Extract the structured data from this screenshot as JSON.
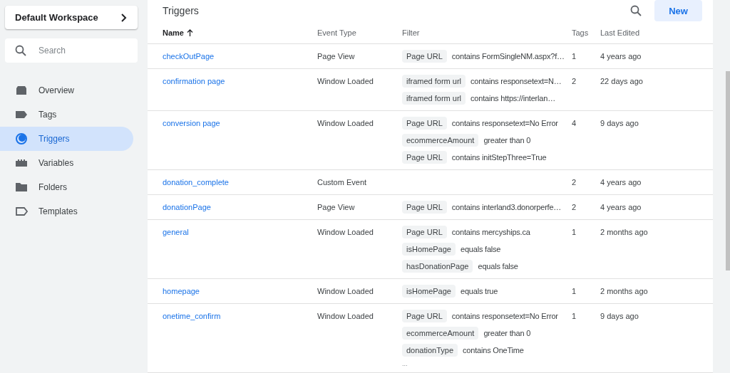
{
  "workspace": {
    "label": "Default Workspace"
  },
  "search": {
    "placeholder": "Search"
  },
  "nav": [
    {
      "label": "Overview",
      "selected": false
    },
    {
      "label": "Tags",
      "selected": false
    },
    {
      "label": "Triggers",
      "selected": true
    },
    {
      "label": "Variables",
      "selected": false
    },
    {
      "label": "Folders",
      "selected": false
    },
    {
      "label": "Templates",
      "selected": false
    }
  ],
  "panel": {
    "title": "Triggers",
    "new_button": "New"
  },
  "table": {
    "columns": [
      "Name",
      "Event Type",
      "Filter",
      "Tags",
      "Last Edited"
    ],
    "rows": [
      {
        "name": "checkOutPage",
        "event": "Page View",
        "filters": [
          {
            "variable": "Page URL",
            "condition": "contains FormSingleNM.aspx?f…"
          }
        ],
        "tags": "1",
        "edited": "4 years ago"
      },
      {
        "name": "confirmation page",
        "event": "Window Loaded",
        "filters": [
          {
            "variable": "iframed form url",
            "condition": "contains responsetext=N…"
          },
          {
            "variable": "iframed form url",
            "condition": "contains https://interlan…"
          }
        ],
        "tags": "2",
        "edited": "22 days ago"
      },
      {
        "name": "conversion page",
        "event": "Window Loaded",
        "filters": [
          {
            "variable": "Page URL",
            "condition": "contains responsetext=No Error"
          },
          {
            "variable": "ecommerceAmount",
            "condition": "greater than 0"
          },
          {
            "variable": "Page URL",
            "condition": "contains initStepThree=True"
          }
        ],
        "tags": "4",
        "edited": "9 days ago"
      },
      {
        "name": "donation_complete",
        "event": "Custom Event",
        "filters": [],
        "tags": "2",
        "edited": "4 years ago"
      },
      {
        "name": "donationPage",
        "event": "Page View",
        "filters": [
          {
            "variable": "Page URL",
            "condition": "contains interland3.donorperfe…"
          }
        ],
        "tags": "2",
        "edited": "4 years ago"
      },
      {
        "name": "general",
        "event": "Window Loaded",
        "filters": [
          {
            "variable": "Page URL",
            "condition": "contains mercyships.ca"
          },
          {
            "variable": "isHomePage",
            "condition": "equals false"
          },
          {
            "variable": "hasDonationPage",
            "condition": "equals false"
          }
        ],
        "tags": "1",
        "edited": "2 months ago"
      },
      {
        "name": "homepage",
        "event": "Window Loaded",
        "filters": [
          {
            "variable": "isHomePage",
            "condition": "equals true"
          }
        ],
        "tags": "1",
        "edited": "2 months ago"
      },
      {
        "name": "onetime_confirm",
        "event": "Window Loaded",
        "filters": [
          {
            "variable": "Page URL",
            "condition": "contains responsetext=No Error"
          },
          {
            "variable": "ecommerceAmount",
            "condition": "greater than 0"
          },
          {
            "variable": "donationType",
            "condition": "contains OneTime"
          }
        ],
        "more": "...",
        "tags": "1",
        "edited": "9 days ago"
      }
    ]
  }
}
